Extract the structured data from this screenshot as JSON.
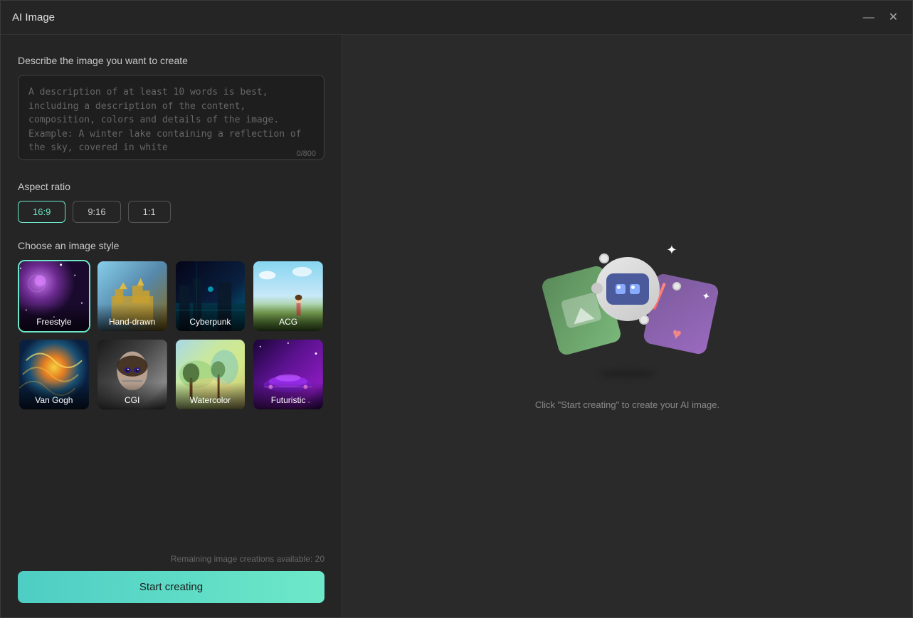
{
  "window": {
    "title": "AI Image"
  },
  "controls": {
    "minimize": "—",
    "close": "✕"
  },
  "left": {
    "describe_label": "Describe the image you want to create",
    "textarea_placeholder": "A description of at least 10 words is best, including a description of the content, composition, colors and details of the image. Example: A winter lake containing a reflection of the sky, covered in white",
    "char_count": "0/800",
    "aspect_label": "Aspect ratio",
    "aspect_options": [
      {
        "value": "16:9",
        "active": true
      },
      {
        "value": "9:16",
        "active": false
      },
      {
        "value": "1:1",
        "active": false
      }
    ],
    "style_label": "Choose an image style",
    "styles": [
      {
        "id": "freestyle",
        "label": "Freestyle",
        "selected": true
      },
      {
        "id": "handdrawn",
        "label": "Hand-drawn",
        "selected": false
      },
      {
        "id": "cyberpunk",
        "label": "Cyberpunk",
        "selected": false
      },
      {
        "id": "acg",
        "label": "ACG",
        "selected": false
      },
      {
        "id": "vangogh",
        "label": "Van Gogh",
        "selected": false
      },
      {
        "id": "cgi",
        "label": "CGI",
        "selected": false
      },
      {
        "id": "watercolor",
        "label": "Watercolor",
        "selected": false
      },
      {
        "id": "futuristic",
        "label": "Futuristic",
        "selected": false
      }
    ],
    "remaining_text": "Remaining image creations available: 20",
    "start_button": "Start creating"
  },
  "right": {
    "hint": "Click \"Start creating\" to create your AI image."
  }
}
